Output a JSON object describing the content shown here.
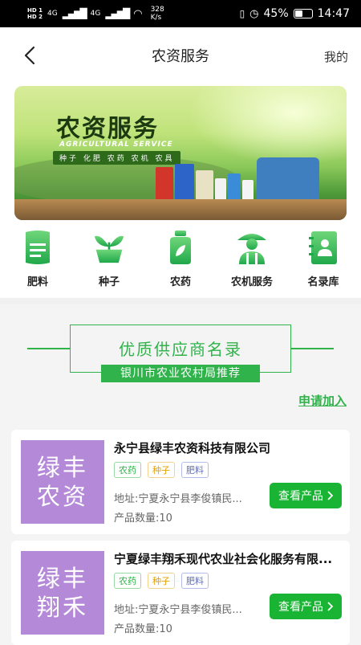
{
  "status_bar": {
    "hd1": "HD 1",
    "hd2": "HD 2",
    "net1": "4G",
    "net2": "4G",
    "speed_value": "328",
    "speed_unit": "K/s",
    "battery": "45%",
    "time": "14:47"
  },
  "header": {
    "title": "农资服务",
    "mine_label": "我的"
  },
  "banner": {
    "title": "农资服务",
    "subtitle": "AGRICULTURAL SERVICE",
    "tags": "种子 化肥 农药 农机 农具"
  },
  "categories": [
    {
      "label": "肥料",
      "icon": "fertilizer-bag-icon"
    },
    {
      "label": "种子",
      "icon": "seedling-icon"
    },
    {
      "label": "农药",
      "icon": "pesticide-bottle-icon"
    },
    {
      "label": "农机服务",
      "icon": "farmer-icon"
    },
    {
      "label": "名录库",
      "icon": "directory-book-icon"
    }
  ],
  "supplier_section": {
    "title": "优质供应商名录",
    "subtitle": "银川市农业农村局推荐",
    "apply_label": "申请加入"
  },
  "suppliers": [
    {
      "logo_line1": "绿丰",
      "logo_line2": "农资",
      "name": "永宁县绿丰农资科技有限公司",
      "tags": [
        "农药",
        "种子",
        "肥料"
      ],
      "address": "地址:宁夏永宁县李俊镇民...",
      "count": "产品数量:10",
      "button_label": "查看产品"
    },
    {
      "logo_line1": "绿丰",
      "logo_line2": "翔禾",
      "name": "宁夏绿丰翔禾现代农业社会化服务有限...",
      "tags": [
        "农药",
        "种子",
        "肥料"
      ],
      "address": "地址:宁夏永宁县李俊镇民...",
      "count": "产品数量:10",
      "button_label": "查看产品"
    }
  ],
  "colors": {
    "brand_green": "#2fb34a",
    "button_green": "#19b433",
    "logo_purple": "#b48ad8"
  }
}
